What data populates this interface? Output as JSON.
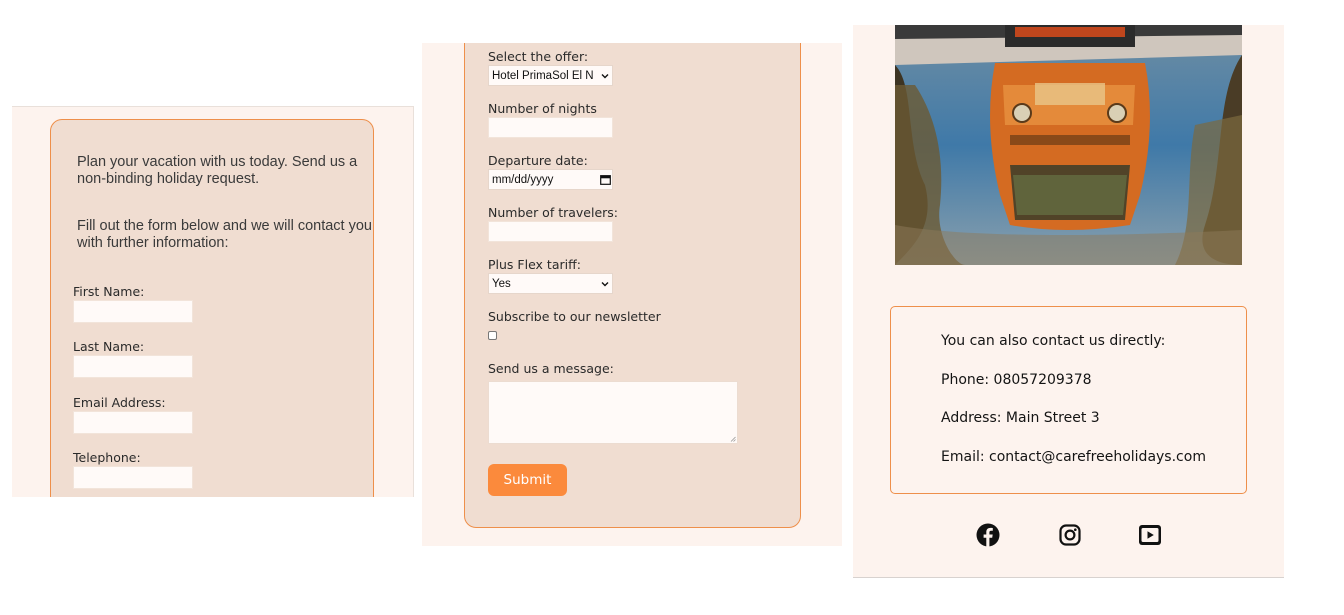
{
  "left_panel": {
    "intro_1": "Plan your vacation with us today. Send us a non-binding holiday request.",
    "intro_2": "Fill out the form below and we will contact you with further information:",
    "fields": [
      {
        "label": "First Name:",
        "value": ""
      },
      {
        "label": "Last Name:",
        "value": ""
      },
      {
        "label": "Email Address:",
        "value": ""
      },
      {
        "label": "Telephone:",
        "value": ""
      }
    ]
  },
  "middle_panel": {
    "offer_label": "Select the offer:",
    "offer_value": "Hotel PrimaSol El N",
    "nights_label": "Number of nights",
    "departure_label": "Departure date:",
    "departure_placeholder": "mm/dd/yyyy",
    "travelers_label": "Number of travelers:",
    "flex_label": "Plus Flex tariff:",
    "flex_value": "Yes",
    "newsletter_label": "Subscribe to our newsletter",
    "message_label": "Send us a message:",
    "submit_label": "Submit"
  },
  "right_panel": {
    "contact_heading": "You can also contact us directly:",
    "phone": "Phone: 08057209378",
    "address": "Address: Main Street 3",
    "email": "Email: contact@carefreeholidays.com",
    "social_icons": [
      "facebook-icon",
      "instagram-icon",
      "youtube-icon"
    ]
  },
  "colors": {
    "accent": "#fb8a3c",
    "card_bg": "#f0ddd1",
    "panel_bg": "#fdf3ee",
    "border": "#ee8f4a"
  }
}
